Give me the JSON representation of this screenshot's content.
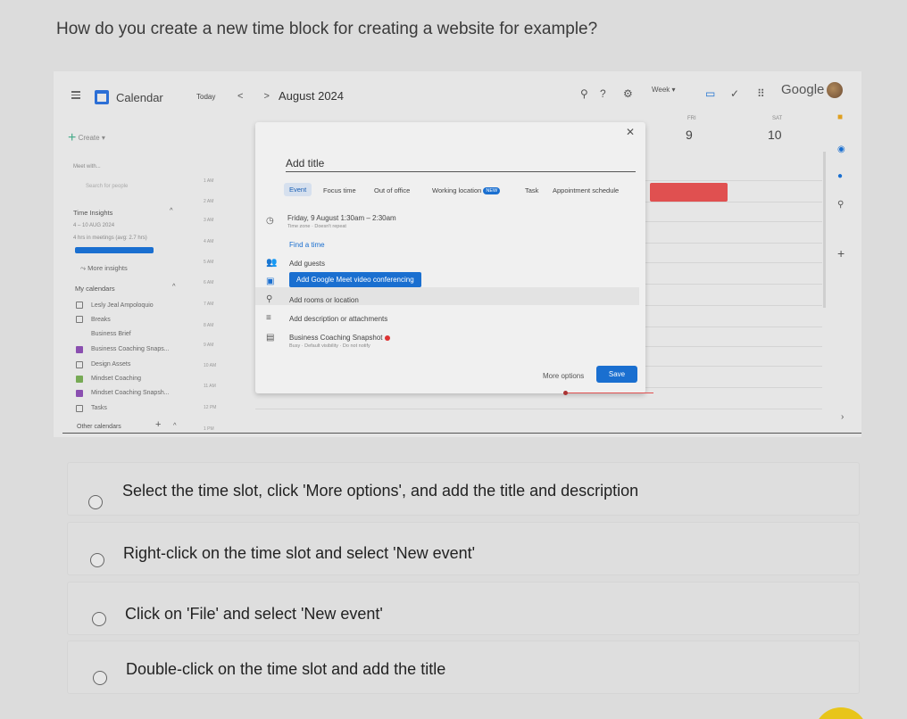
{
  "question": "How do you create a new time block for creating a website for example?",
  "calendar": {
    "app_title": "Calendar",
    "today": "Today",
    "nav": "< >",
    "month": "August 2024",
    "view": "Week",
    "brand": "Google",
    "create": "Create",
    "days": [
      {
        "head": "FRI",
        "num": "9"
      },
      {
        "head": "SAT",
        "num": "10"
      }
    ],
    "sidebar": {
      "meet_with": "Meet with...",
      "search_people": "Search for people",
      "time_insights": "Time Insights",
      "date_range": "4 – 10 AUG 2024",
      "meetings": "4 hrs in meetings (avg: 2.7 hrs)",
      "more_insights": "More insights",
      "my_calendars": "My calendars",
      "calendars": [
        {
          "label": "Lesly Jeal Ampoloquio",
          "checked": false
        },
        {
          "label": "Breaks",
          "checked": false
        },
        {
          "label": "Business Brief",
          "checked": false
        },
        {
          "label": "Business Coaching Snaps...",
          "checked": true
        },
        {
          "label": "Design Assets",
          "checked": false
        },
        {
          "label": "Mindset Coaching",
          "checked": true
        },
        {
          "label": "Mindset Coaching Snapsh...",
          "checked": true
        },
        {
          "label": "Tasks",
          "checked": false
        }
      ],
      "other_calendars": "Other calendars"
    },
    "hours": [
      "1 AM",
      "2 AM",
      "3 AM",
      "4 AM",
      "5 AM",
      "6 AM",
      "7 AM",
      "8 AM",
      "9 AM",
      "10 AM",
      "11 AM",
      "12 PM",
      "1 PM"
    ],
    "dialog": {
      "title_placeholder": "Add title",
      "tabs": [
        "Event",
        "Focus time",
        "Out of office",
        "Working location",
        "Task",
        "Appointment schedule"
      ],
      "new_badge": "NEW",
      "datetime": "Friday, 9 August   1:30am  –  2:30am",
      "timezone": "Time zone · Doesn't repeat",
      "find_time": "Find a time",
      "add_guests": "Add guests",
      "meet_button": "Add Google Meet video conferencing",
      "add_rooms": "Add rooms or location",
      "add_description": "Add description or attachments",
      "calendar_name": "Business Coaching Snapshot",
      "visibility": "Busy · Default visibility · Do not notify",
      "more_options": "More options",
      "save": "Save"
    }
  },
  "options": [
    "Select the time slot, click 'More options', and add the title and description",
    "Right-click on the time slot and select 'New event'",
    "Click on 'File' and select 'New event'",
    "Double-click on the time slot and add the title"
  ]
}
